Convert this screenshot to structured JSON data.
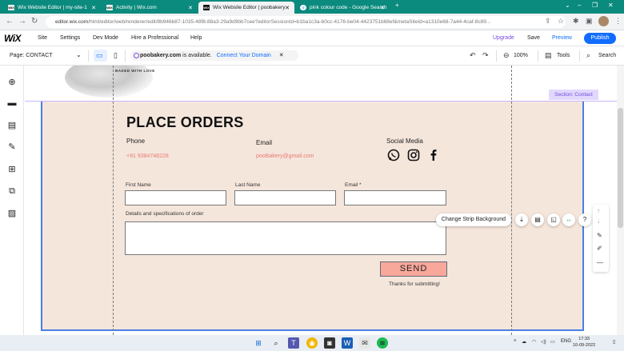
{
  "browser": {
    "tabs": [
      {
        "label": "Wix Website Editor | my-site-1",
        "favicon": "WIX"
      },
      {
        "label": "Activity | Wix.com",
        "favicon": "WIX"
      },
      {
        "label": "Wix Website Editor | poobakery",
        "favicon": "WIX",
        "active": true
      },
      {
        "label": "pink colour code - Google Search",
        "favicon": "G"
      }
    ],
    "url_host": "editor.wix.com",
    "url_path": "/html/editor/web/renderer/edit/8b946b87-1035-48f8-88a3-29a9d9bb7cee?editorSessionId=b1ba1c3a-b0cc-4176-be04-4423751b68ef&metaSiteId=a1310e68-7a44-4caf-8c89..."
  },
  "wix_top": {
    "menu": [
      "Site",
      "Settings",
      "Dev Mode",
      "Hire a Professional",
      "Help"
    ],
    "upgrade": "Upgrade",
    "save": "Save",
    "preview": "Preview",
    "publish": "Publish"
  },
  "wix_bar2": {
    "page_selector": "Page: CONTACT",
    "domain_name": "poobakery.com",
    "domain_status": "is available.",
    "domain_link": "Connect Your Domain",
    "zoom": "100%",
    "tools": "Tools",
    "search": "Search"
  },
  "header_logo_text": "BAKED WITH LOVE",
  "section_label": "Section: Contact",
  "contact": {
    "title": "PLACE ORDERS",
    "phone_heading": "Phone",
    "phone_value": "+91 9384748228",
    "email_heading": "Email",
    "email_value": "pooBakery@gmail.com",
    "social_heading": "Social Media",
    "social_icons": [
      "whatsapp-icon",
      "instagram-icon",
      "facebook-icon"
    ],
    "form": {
      "first_name_label": "First Name",
      "last_name_label": "Last Name",
      "email_label": "Email *",
      "details_label": "Details and specifications of order",
      "send_label": "SEND",
      "thanks": "Thanks for submitting!"
    }
  },
  "strip_toolbar": {
    "change_bg": "Change Strip Background"
  },
  "taskbar": {
    "lang": "ENG",
    "time": "17:33",
    "date": "10-09-2022"
  },
  "colors": {
    "accent": "#116dff",
    "section_bg": "#f5e6dc",
    "send_bg": "#f8a79b",
    "contact_text": "#e87a72",
    "browser_frame": "#0b8a7e"
  }
}
